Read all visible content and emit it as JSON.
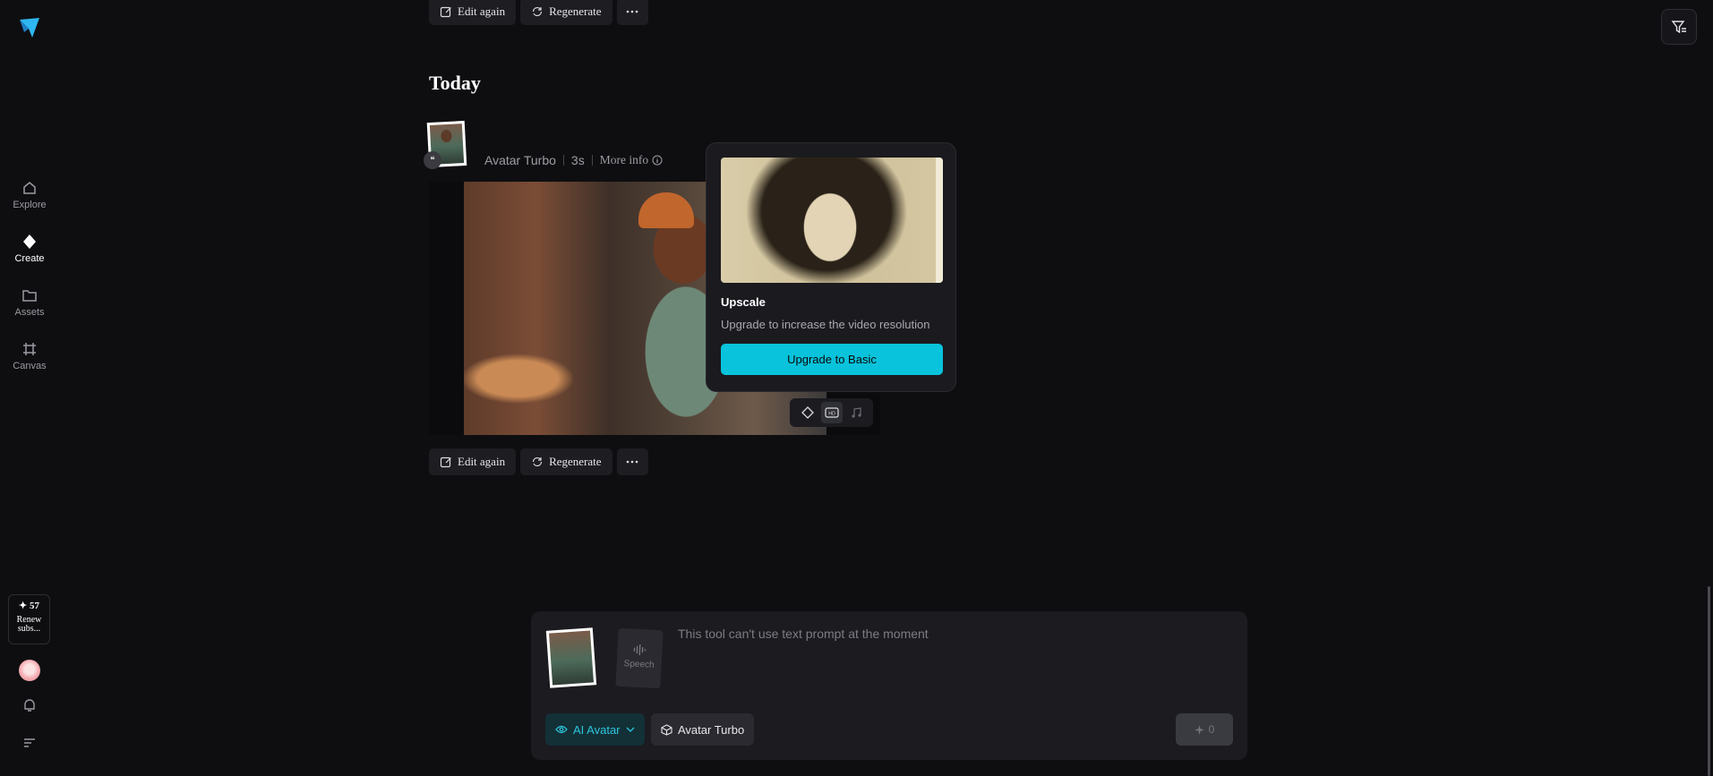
{
  "nav": {
    "items": [
      {
        "label": "Explore",
        "icon": "home-icon"
      },
      {
        "label": "Create",
        "icon": "diamond-icon"
      },
      {
        "label": "Assets",
        "icon": "folder-icon"
      },
      {
        "label": "Canvas",
        "icon": "canvas-icon"
      }
    ],
    "active": "Create"
  },
  "credits": {
    "count": "✦ 57",
    "line1": "Renew",
    "line2": "subs..."
  },
  "top_actions": {
    "edit": "Edit again",
    "regenerate": "Regenerate"
  },
  "section": {
    "title": "Today"
  },
  "generation": {
    "model": "Avatar Turbo",
    "duration": "3s",
    "more_info": "More info",
    "actions": {
      "edit": "Edit again",
      "regenerate": "Regenerate"
    }
  },
  "popover": {
    "title": "Upscale",
    "description": "Upgrade to increase the video resolution",
    "button": "Upgrade to Basic"
  },
  "composer": {
    "speech_label": "Speech",
    "prompt_placeholder": "This tool can't use text prompt at the moment",
    "mode_chip": "AI Avatar",
    "model_chip": "Avatar Turbo",
    "cost": "0"
  },
  "colors": {
    "accent": "#08c3db",
    "background": "#0e0e11"
  }
}
